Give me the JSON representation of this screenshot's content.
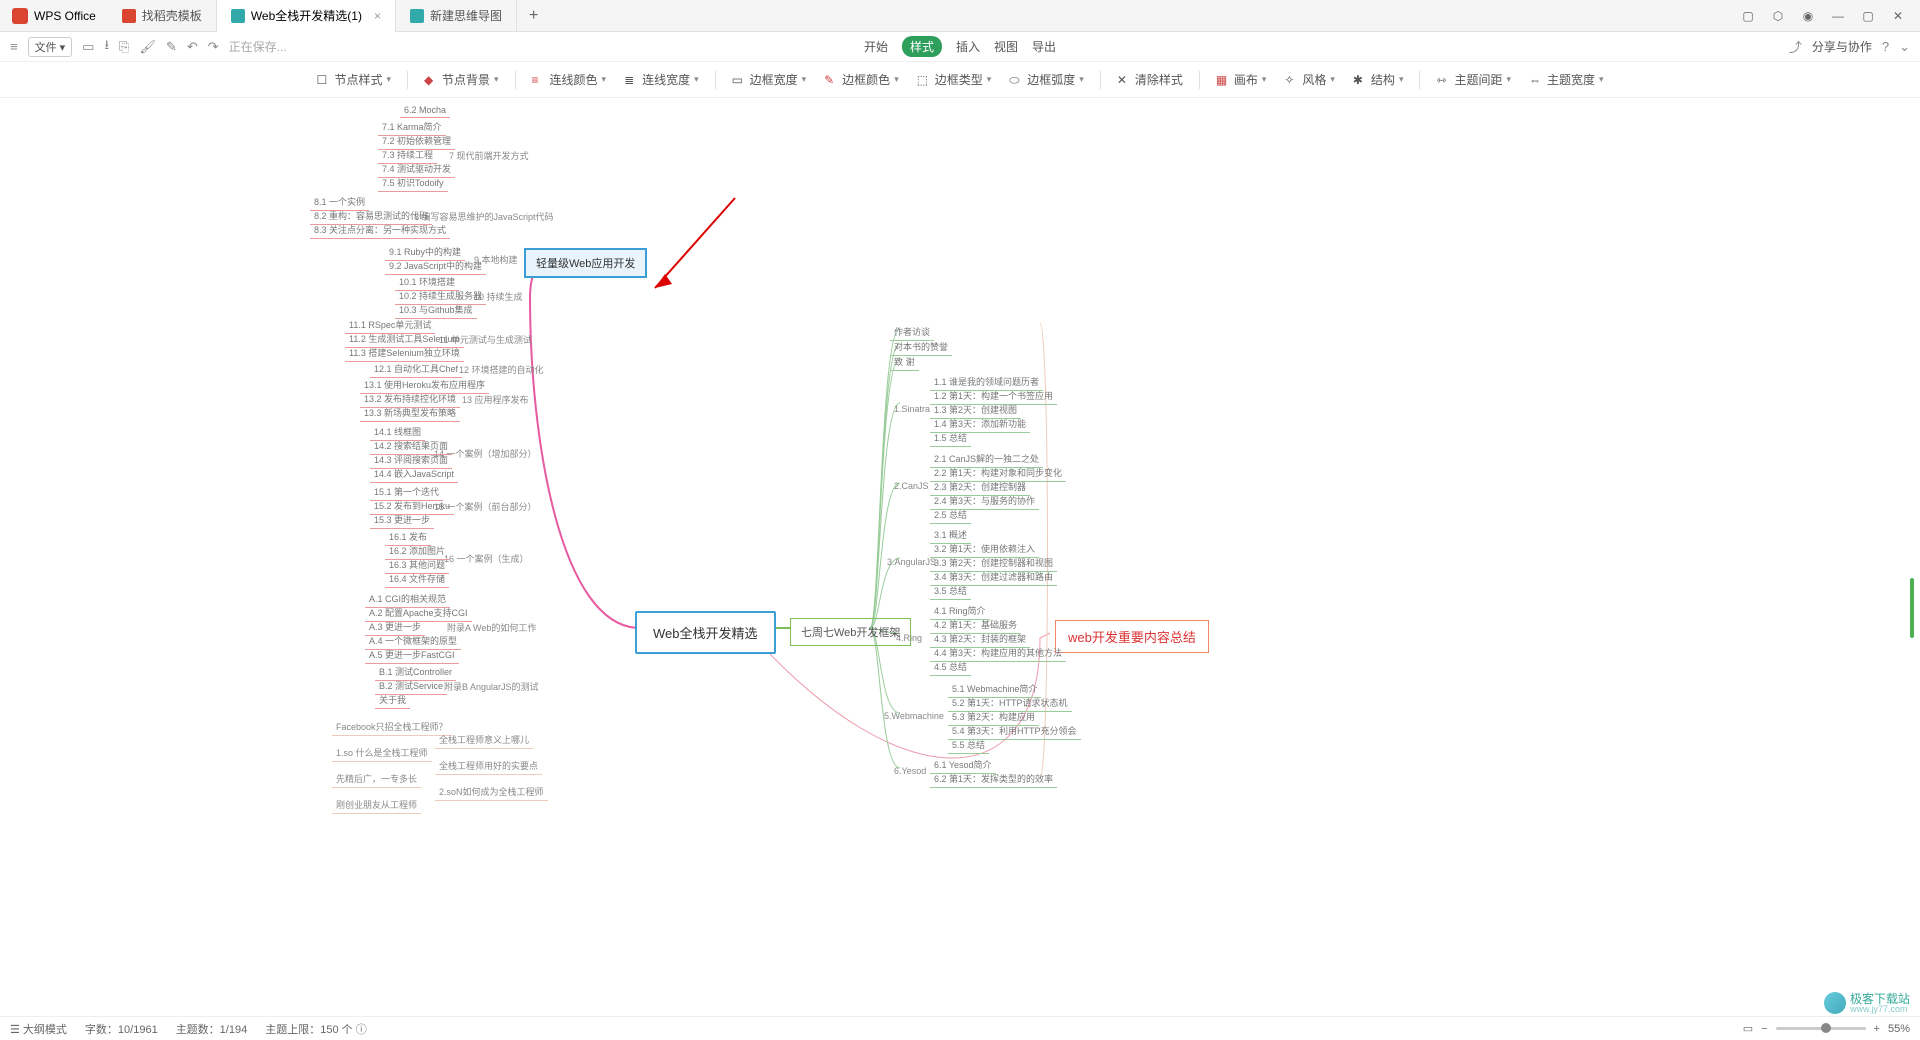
{
  "titlebar": {
    "app": "WPS Office",
    "tabs": [
      {
        "label": "找稻壳模板",
        "icon": "#d94530"
      },
      {
        "label": "Web全栈开发精选(1)",
        "icon": "#3a8",
        "active": true,
        "closable": true
      },
      {
        "label": "新建思维导图",
        "icon": "#3a8"
      }
    ]
  },
  "menubar": {
    "file": "文件",
    "saving": "正在保存...",
    "center": [
      "开始",
      "样式",
      "插入",
      "视图",
      "导出"
    ],
    "share": "分享与协作"
  },
  "toolbar": [
    {
      "label": "节点样式"
    },
    {
      "label": "节点背景"
    },
    {
      "label": "连线颜色"
    },
    {
      "label": "连线宽度"
    },
    {
      "label": "边框宽度"
    },
    {
      "label": "边框颜色"
    },
    {
      "label": "边框类型"
    },
    {
      "label": "边框弧度"
    },
    {
      "label": "清除样式"
    },
    {
      "label": "画布"
    },
    {
      "label": "风格"
    },
    {
      "label": "结构"
    },
    {
      "label": "主题间距"
    },
    {
      "label": "主题宽度"
    }
  ],
  "status": {
    "mode": "大纲模式",
    "words": "字数：10/1961",
    "topics": "主题数：1/194",
    "upper": "主题上限：150 个",
    "zoom": "55%"
  },
  "watermark": {
    "site": "极客下载站",
    "url": "www.jy77.com"
  },
  "mindmap": {
    "root": "Web全栈开发精选",
    "highlight": "轻量级Web应用开发",
    "right_hub": "七周七Web开发框架",
    "red": "web开发重要内容总结",
    "left": {
      "g0": {
        "label": "",
        "items": [
          "6.2 Mocha"
        ]
      },
      "g1": {
        "label": "7 现代前端开发方式",
        "items": [
          "7.1 Karma简介",
          "7.2 初始依赖管理",
          "7.3 持续工程",
          "7.4 测试驱动开发",
          "7.5 初识Todoify"
        ]
      },
      "g2": {
        "label": "8 编写容易思维护的JavaScript代码",
        "items": [
          "8.1 一个实例",
          "8.2 重构：容易思测试的代码",
          "8.3 关注点分离：另一种实现方式"
        ]
      },
      "g3": {
        "label": "9 本地构建",
        "items": [
          "9.1 Ruby中的构建",
          "9.2 JavaScript中的构建"
        ]
      },
      "g4": {
        "label": "10 持续生成",
        "items": [
          "10.1 环境搭建",
          "10.2 持续生成服务器",
          "10.3 与Github集成"
        ]
      },
      "g5": {
        "label": "11 单元测试与生成测试",
        "items": [
          "11.1 RSpec单元测试",
          "11.2 生成测试工具Selenium",
          "11.3 搭建Selenium独立环境"
        ]
      },
      "g6": {
        "label": "12 环境搭建的自动化",
        "items": [
          "12.1 自动化工具Chef"
        ]
      },
      "g7": {
        "label": "13 应用程序发布",
        "items": [
          "13.1 使用Heroku发布应用程序",
          "13.2 发布持续控化环境",
          "13.3 新场典型发布策略"
        ]
      },
      "g8": {
        "label": "14 一个案例（增加部分）",
        "items": [
          "14.1 线框图",
          "14.2 搜索结果页面",
          "14.3 评阅搜索页面",
          "14.4 嵌入JavaScript"
        ]
      },
      "g9": {
        "label": "15 一个案例（前台部分）",
        "items": [
          "15.1 第一个迭代",
          "15.2 发布到Heroku",
          "15.3 更进一步"
        ]
      },
      "g10": {
        "label": "16 一个案例（生成）",
        "items": [
          "16.1 发布",
          "16.2 添加图片",
          "16.3 其他问题",
          "16.4 文件存储"
        ]
      },
      "g11": {
        "label": "附录A Web的如何工作",
        "items": [
          "A.1 CGI的相关规范",
          "A.2 配置Apache支持CGI",
          "A.3 更进一步",
          "A.4 一个微框架的原型",
          "A.5 更进一步FastCGI"
        ]
      },
      "g12": {
        "label": "附录B AngularJS的测试",
        "items": [
          "B.1 测试Controller",
          "B.2 测试Service",
          "关于我"
        ]
      },
      "bottom": {
        "label": "",
        "items": [
          "Facebook只招全栈工程师？",
          "全栈工程师意义上哪儿",
          "1.so 什么是全栈工程师",
          "全栈工程师用好的实要点",
          "先精后广，一专多长",
          "2.soN如何成为全栈工程师",
          "刚创业朋友从工程师"
        ]
      }
    },
    "right": {
      "top_items": [
        "作者访谈",
        "对本书的赞誉",
        "致 谢"
      ],
      "ch1": {
        "label": "1.Sinatra",
        "items": [
          "1.1 谁是我的领域问题历者",
          "1.2 第1天：构建一个书签应用",
          "1.3 第2天：创建视图",
          "1.4 第3天：添加新功能",
          "1.5 总结"
        ]
      },
      "ch2": {
        "label": "2.CanJS",
        "items": [
          "2.1 CanJS解的一独二之处",
          "2.2 第1天：构建对象和同步变化",
          "2.3 第2天：创建控制器",
          "2.4 第3天：与服务的协作",
          "2.5 总结"
        ]
      },
      "ch3": {
        "label": "3.AngularJS",
        "items": [
          "3.1 概述",
          "3.2 第1天：使用依赖注入",
          "3.3 第2天：创建控制器和视图",
          "3.4 第3天：创建过滤器和路由",
          "3.5 总结"
        ]
      },
      "ch4": {
        "label": "4.Ring",
        "items": [
          "4.1 Ring简介",
          "4.2 第1天：基础服务",
          "4.3 第2天：封装的框架",
          "4.4 第3天：构建应用的其他方法",
          "4.5 总结"
        ]
      },
      "ch5": {
        "label": "5.Webmachine",
        "items": [
          "5.1 Webmachine简介",
          "5.2 第1天：HTTP请求状态机",
          "5.3 第2天：构建应用",
          "5.4 第3天：利用HTTP充分领会",
          "5.5 总结"
        ]
      },
      "ch6": {
        "label": "6.Yesod",
        "items": [
          "6.1 Yesod简介",
          "6.2 第1天：发挥类型的的效率"
        ]
      }
    }
  }
}
